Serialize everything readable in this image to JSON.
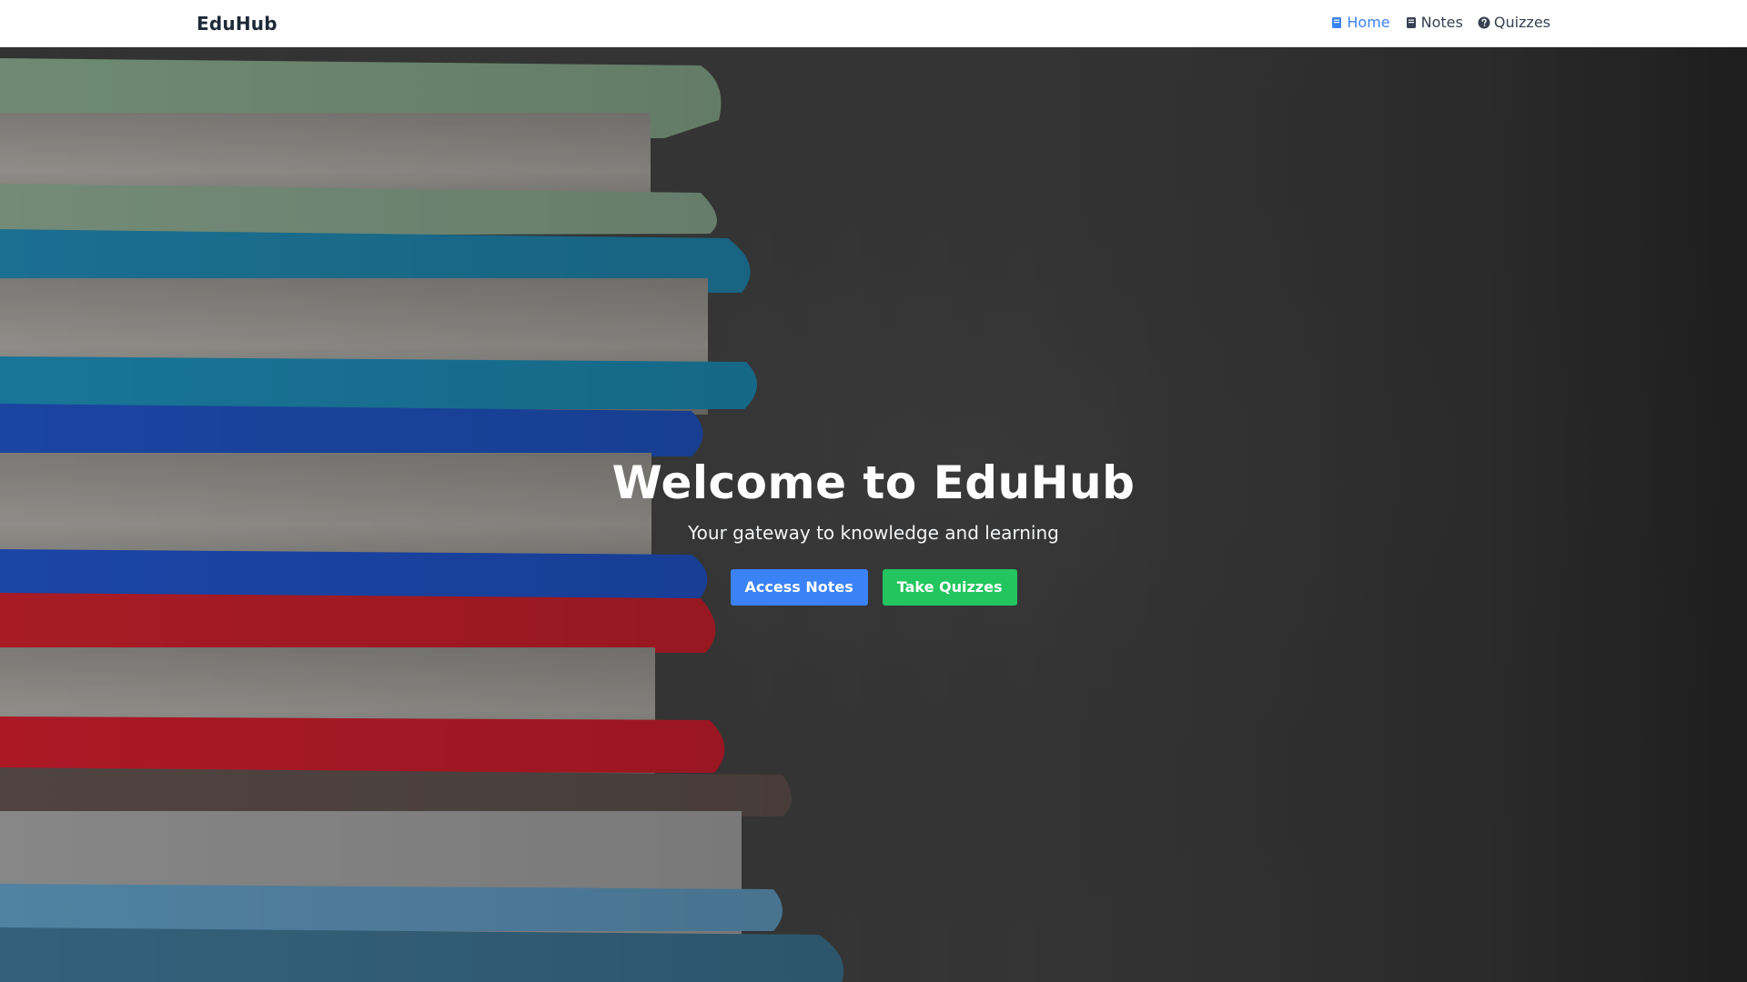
{
  "navbar": {
    "brand": "EduHub",
    "links": [
      {
        "label": "Home",
        "icon": "book-icon",
        "active": true
      },
      {
        "label": "Notes",
        "icon": "notebook-icon",
        "active": false
      },
      {
        "label": "Quizzes",
        "icon": "question-circle-icon",
        "active": false
      }
    ]
  },
  "hero": {
    "title": "Welcome to EduHub",
    "subtitle": "Your gateway to knowledge and learning",
    "buttons": {
      "notes": "Access Notes",
      "quizzes": "Take Quizzes"
    },
    "background_image": "stack-of-books-photo"
  },
  "colors": {
    "primary": "#3b82f6",
    "success": "#22c55e",
    "nav_text": "#374151",
    "brand_text": "#1f2937"
  }
}
